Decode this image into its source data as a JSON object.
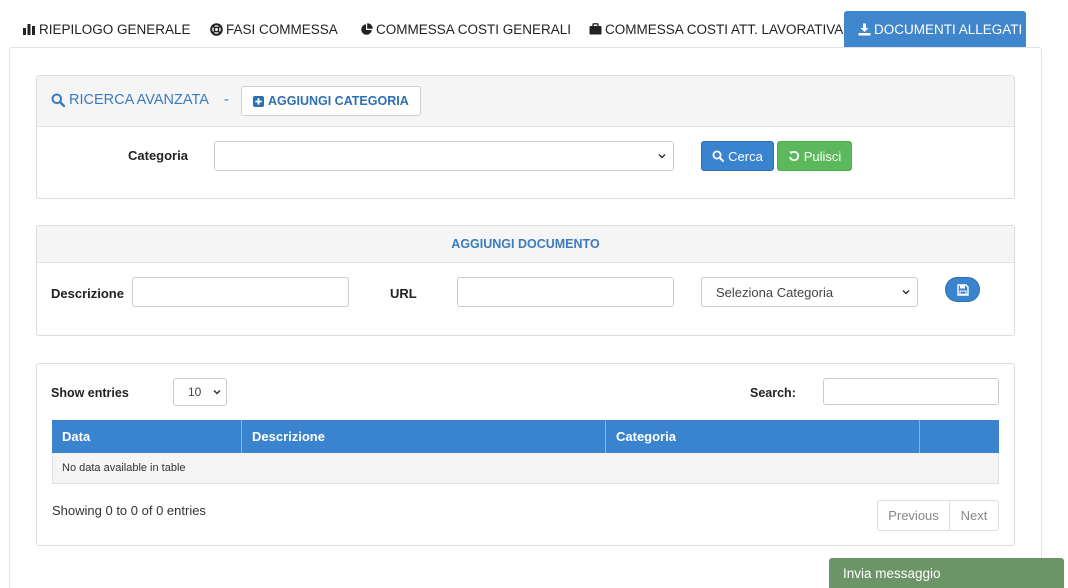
{
  "tabs": [
    {
      "label": "RIEPILOGO GENERALE",
      "icon": "bar-chart-icon"
    },
    {
      "label": "FASI COMMESSA",
      "icon": "lifebuoy-icon"
    },
    {
      "label": "COMMESSA COSTI GENERALI",
      "icon": "pie-chart-icon"
    },
    {
      "label": "COMMESSA COSTI ATT. LAVORATIVA",
      "icon": "briefcase-icon"
    },
    {
      "label": "DOCUMENTI ALLEGATI",
      "icon": "download-icon",
      "active": true
    }
  ],
  "search": {
    "title": "RICERCA AVANZATA",
    "separator": "-",
    "add_category_label": "AGGIUNGI CATEGORIA",
    "category_label": "Categoria",
    "category_value": "",
    "search_button": "Cerca",
    "clear_button": "Pulisci"
  },
  "add_document": {
    "title": "AGGIUNGI DOCUMENTO",
    "description_label": "Descrizione",
    "description_value": "",
    "url_label": "URL",
    "url_value": "",
    "category_select": "Seleziona Categoria"
  },
  "table": {
    "show_entries_label": "Show entries",
    "entries_value": "10",
    "search_label": "Search:",
    "search_value": "",
    "columns": [
      "Data",
      "Descrizione",
      "Categoria",
      ""
    ],
    "empty_message": "No data available in table",
    "info": "Showing 0 to 0 of 0 entries",
    "previous": "Previous",
    "next": "Next"
  },
  "chat": {
    "label": "Invia messaggio"
  },
  "colors": {
    "primary": "#3a83cf",
    "success": "#5cb85c",
    "chat": "#6b9467"
  }
}
